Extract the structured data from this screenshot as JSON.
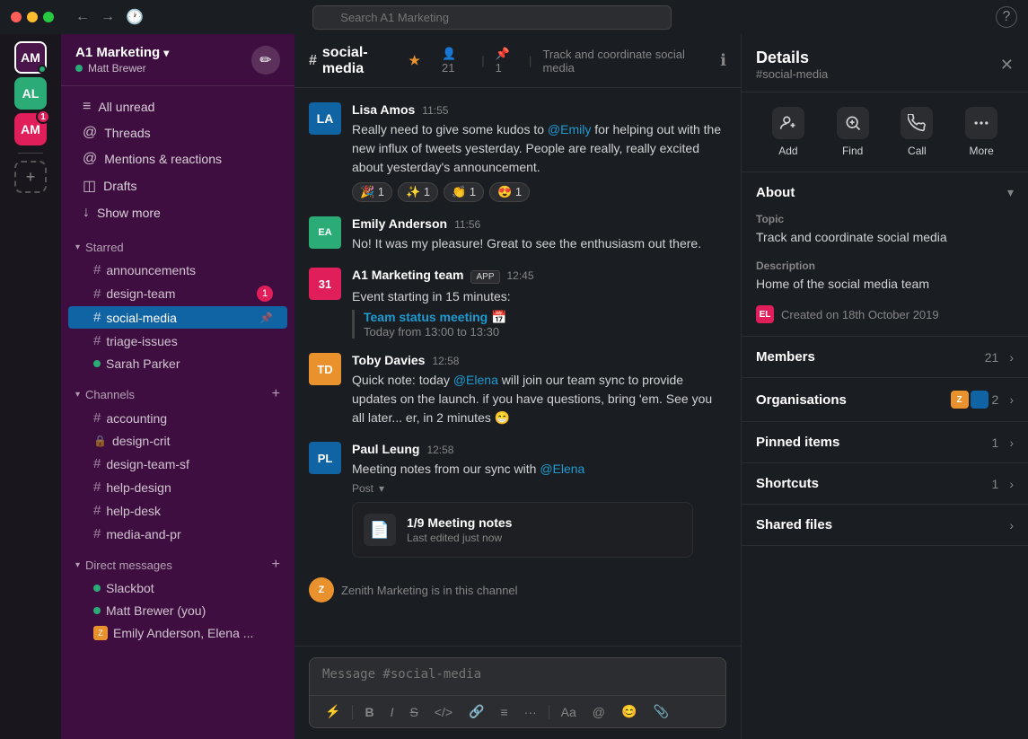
{
  "titlebar": {
    "search_placeholder": "Search A1 Marketing",
    "nav_back": "←",
    "nav_forward": "→",
    "history": "🕐"
  },
  "sidebar": {
    "workspace_name": "A1 Marketing",
    "username": "Matt Brewer",
    "nav_items": [
      {
        "id": "all-unread",
        "label": "All unread",
        "icon": "≡"
      },
      {
        "id": "threads",
        "label": "Threads",
        "icon": "@"
      },
      {
        "id": "mentions",
        "label": "Mentions & reactions",
        "icon": "@"
      },
      {
        "id": "drafts",
        "label": "Drafts",
        "icon": "◫"
      },
      {
        "id": "show-more",
        "label": "Show more",
        "icon": "↓"
      }
    ],
    "starred_label": "Starred",
    "starred_channels": [
      {
        "name": "announcements",
        "type": "hash"
      },
      {
        "name": "design-team",
        "type": "hash",
        "badge": 1
      },
      {
        "name": "social-media",
        "type": "hash",
        "active": true
      },
      {
        "name": "triage-issues",
        "type": "hash"
      },
      {
        "name": "Sarah Parker",
        "type": "dm",
        "status": "online"
      }
    ],
    "channels_label": "Channels",
    "channels": [
      {
        "name": "accounting",
        "type": "hash"
      },
      {
        "name": "design-crit",
        "type": "lock"
      },
      {
        "name": "design-team-sf",
        "type": "hash"
      },
      {
        "name": "help-design",
        "type": "hash"
      },
      {
        "name": "help-desk",
        "type": "hash"
      },
      {
        "name": "media-and-pr",
        "type": "hash"
      }
    ],
    "dm_label": "Direct messages",
    "dms": [
      {
        "name": "Slackbot",
        "status": "online"
      },
      {
        "name": "Matt Brewer (you)",
        "status": "online"
      },
      {
        "name": "Emily Anderson, Elena ...",
        "status": "app"
      }
    ]
  },
  "channel": {
    "name": "#social-media",
    "star": "★",
    "members": "21",
    "pinned": "1",
    "description": "Track and coordinate social media"
  },
  "messages": [
    {
      "id": "msg1",
      "author": "Lisa Amos",
      "time": "11:55",
      "avatar_initials": "LA",
      "avatar_color": "blue",
      "text": "Really need to give some kudos to @Emily for helping out with the new influx of tweets yesterday. People are really, really excited about yesterday's announcement.",
      "mention": "@Emily",
      "reactions": [
        "🎉 1",
        "✨ 1",
        "👏 1",
        "😍 1"
      ]
    },
    {
      "id": "msg2",
      "author": "Emily Anderson",
      "time": "11:56",
      "avatar_initials": "EA",
      "avatar_color": "green",
      "text": "No! It was my pleasure! Great to see the enthusiasm out there."
    },
    {
      "id": "msg3",
      "author": "A1 Marketing team",
      "time": "12:45",
      "is_app": true,
      "app_badge": "APP",
      "avatar_text": "31",
      "avatar_color": "pink",
      "text": "Event starting in 15 minutes:",
      "quoted_link": "Team status meeting 📅",
      "quoted_text": "Today from 13:00 to 13:30"
    },
    {
      "id": "msg4",
      "author": "Toby Davies",
      "time": "12:58",
      "avatar_initials": "TD",
      "avatar_color": "orange",
      "text_before": "Quick note: today ",
      "mention": "@Elena",
      "text_after": " will join our team sync to provide updates on the launch. if you have questions, bring 'em. See you all later... er, in 2 minutes 😁"
    },
    {
      "id": "msg5",
      "author": "Paul Leung",
      "time": "12:58",
      "avatar_initials": "PL",
      "avatar_color": "blue",
      "text_before": "Meeting notes from our sync with ",
      "mention": "@Elena",
      "post_label": "Post",
      "post_title": "1/9 Meeting notes",
      "post_meta": "Last edited just now"
    }
  ],
  "system_msg": "Zenith Marketing is in this channel",
  "input_placeholder": "Message #social-media",
  "toolbar_buttons": [
    "⚡",
    "B",
    "I",
    "S",
    "</>",
    "🔗",
    "≡",
    "···",
    "Aa",
    "@",
    "😊",
    "📎"
  ],
  "details": {
    "title": "Details",
    "channel_name": "#social-media",
    "actions": [
      {
        "label": "Add",
        "icon": "👤+"
      },
      {
        "label": "Find",
        "icon": "🔍"
      },
      {
        "label": "Call",
        "icon": "📞"
      },
      {
        "label": "More",
        "icon": "···"
      }
    ],
    "about": {
      "label": "About",
      "topic_label": "Topic",
      "topic_value": "Track and coordinate social media",
      "description_label": "Description",
      "description_value": "Home of the social media team",
      "created_label": "Created on 18th October 2019",
      "creator_initials": "EL"
    },
    "sections": [
      {
        "label": "Members",
        "count": 21
      },
      {
        "label": "Organisations",
        "count": 2
      },
      {
        "label": "Pinned items",
        "count": 1
      },
      {
        "label": "Shortcuts",
        "count": 1
      },
      {
        "label": "Shared files",
        "count": null
      }
    ]
  }
}
